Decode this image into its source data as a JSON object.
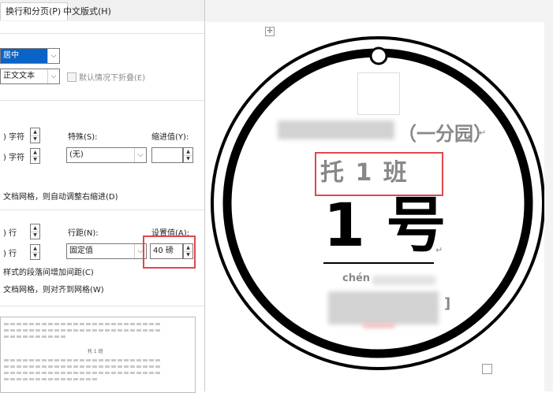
{
  "tabs": {
    "active": "换行和分页(P)",
    "other": "中文版式(H)"
  },
  "general": {
    "alignment_value": "居中",
    "outline_value": "正文文本",
    "collapse_label": "默认情况下折叠(E)"
  },
  "indent": {
    "left_value": ") 字符",
    "right_value": ") 字符",
    "special_label": "特殊(S):",
    "special_value": "(无)",
    "indent_by_label": "缩进值(Y):",
    "auto_adjust_text": "文档网格，则自动调整右缩进(D)"
  },
  "spacing": {
    "before_value": ") 行",
    "after_value": ") 行",
    "line_spacing_label": "行距(N):",
    "line_spacing_value": "固定值",
    "at_label": "设置值(A):",
    "at_value": "40 磅",
    "no_space_text": "样式的段落间增加间距(C)",
    "snap_grid_text": "文档网格，则对齐到网格(W)"
  },
  "preview": {
    "sample_text": "托 1 班"
  },
  "document": {
    "move_handle": "✛",
    "subtitle": "（一分园）",
    "class_name": "托 1 班",
    "number": "1 号",
    "pinyin": "chén",
    "bracket": "]",
    "para_mark": "↵"
  },
  "colors": {
    "highlight_red": "#e0484d",
    "selection_blue": "#0a64c8"
  }
}
